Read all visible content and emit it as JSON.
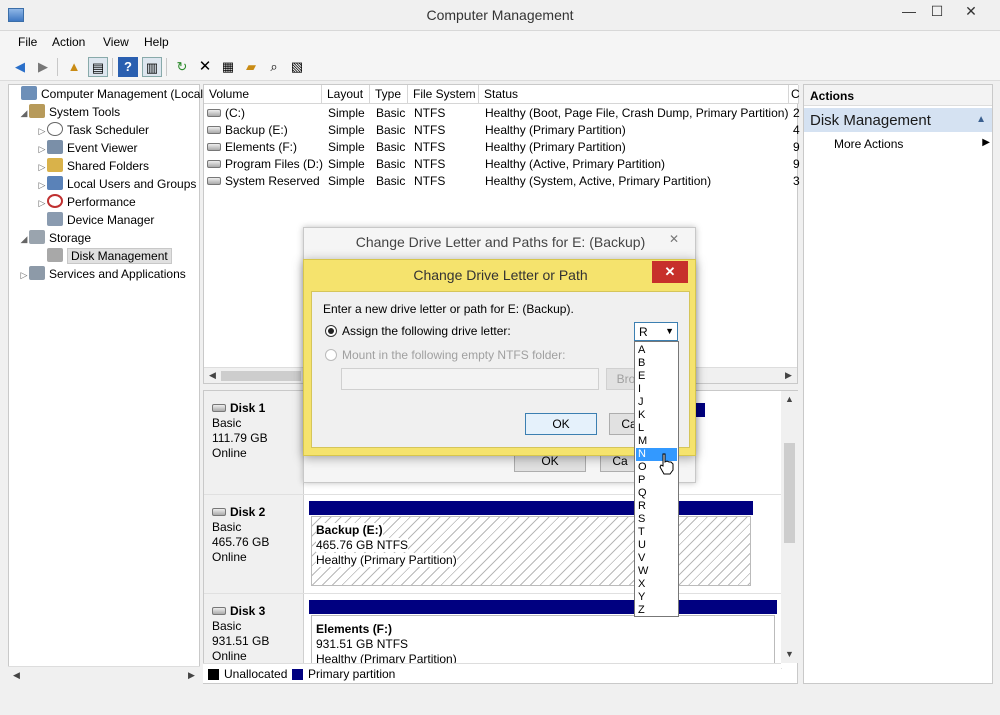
{
  "window": {
    "title": "Computer Management",
    "min": "—",
    "max": "☐",
    "close": "✕"
  },
  "menu": [
    "File",
    "Action",
    "View",
    "Help"
  ],
  "tree": [
    {
      "label": "Computer Management (Local",
      "level": 0
    },
    {
      "label": "System Tools",
      "level": 1
    },
    {
      "label": "Task Scheduler",
      "level": 2
    },
    {
      "label": "Event Viewer",
      "level": 2
    },
    {
      "label": "Shared Folders",
      "level": 2
    },
    {
      "label": "Local Users and Groups",
      "level": 2
    },
    {
      "label": "Performance",
      "level": 2
    },
    {
      "label": "Device Manager",
      "level": 2
    },
    {
      "label": "Storage",
      "level": 1
    },
    {
      "label": "Disk Management",
      "level": 2
    },
    {
      "label": "Services and Applications",
      "level": 1
    }
  ],
  "volumes": {
    "columns": [
      "Volume",
      "Layout",
      "Type",
      "File System",
      "Status",
      "C"
    ],
    "rows": [
      [
        "(C:)",
        "Simple",
        "Basic",
        "NTFS",
        "Healthy (Boot, Page File, Crash Dump, Primary Partition)",
        "2"
      ],
      [
        "Backup (E:)",
        "Simple",
        "Basic",
        "NTFS",
        "Healthy (Primary Partition)",
        "4"
      ],
      [
        "Elements (F:)",
        "Simple",
        "Basic",
        "NTFS",
        "Healthy (Primary Partition)",
        "9"
      ],
      [
        "Program Files (D:)",
        "Simple",
        "Basic",
        "NTFS",
        "Healthy (Active, Primary Partition)",
        "9"
      ],
      [
        "System Reserved",
        "Simple",
        "Basic",
        "NTFS",
        "Healthy (System, Active, Primary Partition)",
        "3"
      ]
    ]
  },
  "disks": [
    {
      "name": "Disk 1",
      "type": "Basic",
      "size": "111.79 GB",
      "status": "Online"
    },
    {
      "name": "Disk 2",
      "type": "Basic",
      "size": "465.76 GB",
      "status": "Online",
      "part_title": "Backup  (E:)",
      "part_size": "465.76 GB NTFS",
      "part_status": "Healthy (Primary Partition)"
    },
    {
      "name": "Disk 3",
      "type": "Basic",
      "size": "931.51 GB",
      "status": "Online",
      "part_title": "Elements  (F:)",
      "part_size": "931.51 GB NTFS",
      "part_status": "Healthy (Primary Partition)"
    }
  ],
  "legend": {
    "unallocated": "Unallocated",
    "primary": "Primary partition"
  },
  "actions": {
    "header": "Actions",
    "section": "Disk Management",
    "more": "More Actions"
  },
  "bg_dialog": {
    "title": "Change Drive Letter and Paths for E: (Backup)",
    "ok": "OK",
    "cancel": "Ca"
  },
  "dialog": {
    "title": "Change Drive Letter or Path",
    "prompt": "Enter a new drive letter or path for E: (Backup).",
    "assign_label": "Assign the following drive letter:",
    "mount_label": "Mount in the following empty NTFS folder:",
    "browse": "Bro",
    "ok": "OK",
    "cancel": "Ca",
    "selected_letter": "R"
  },
  "letters": [
    "A",
    "B",
    "E",
    "I",
    "J",
    "K",
    "L",
    "M",
    "N",
    "O",
    "P",
    "Q",
    "R",
    "S",
    "T",
    "U",
    "V",
    "W",
    "X",
    "Y",
    "Z"
  ],
  "highlighted_letter": "N",
  "colors": {
    "primary_partition": "#000080",
    "selection": "#3399ff",
    "dialog_accent": "#f5e36d",
    "close_red": "#c7302b"
  }
}
